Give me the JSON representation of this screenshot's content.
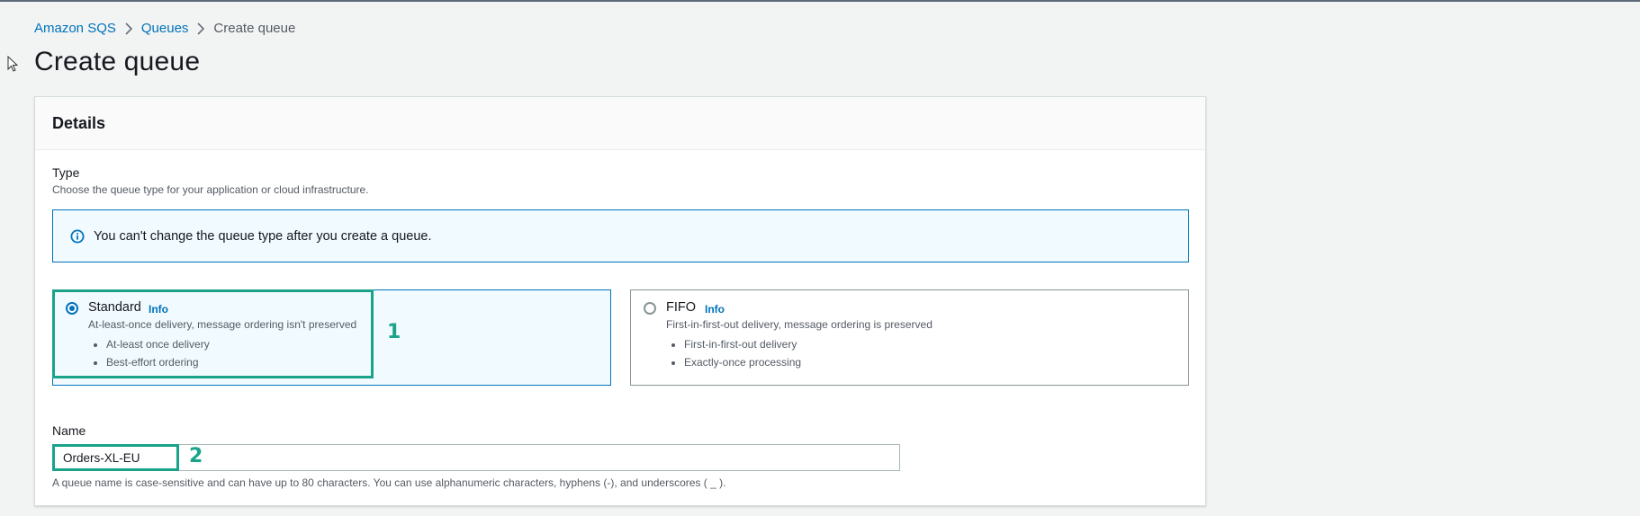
{
  "breadcrumb": {
    "items": [
      "Amazon SQS",
      "Queues"
    ],
    "current": "Create queue"
  },
  "page": {
    "title": "Create queue"
  },
  "details": {
    "header": "Details",
    "type": {
      "label": "Type",
      "description": "Choose the queue type for your application or cloud infrastructure.",
      "alert": "You can't change the queue type after you create a queue.",
      "options": [
        {
          "title": "Standard",
          "info": "Info",
          "description": "At-least-once delivery, message ordering isn't preserved",
          "bullets": [
            "At-least once delivery",
            "Best-effort ordering"
          ],
          "selected": true
        },
        {
          "title": "FIFO",
          "info": "Info",
          "description": "First-in-first-out delivery, message ordering is preserved",
          "bullets": [
            "First-in-first-out delivery",
            "Exactly-once processing"
          ],
          "selected": false
        }
      ]
    },
    "name": {
      "label": "Name",
      "value": "Orders-XL-EU",
      "hint": "A queue name is case-sensitive and can have up to 80 characters. You can use alphanumeric characters, hyphens (-), and underscores ( _ )."
    }
  },
  "annotations": [
    "1",
    "2"
  ],
  "colors": {
    "link": "#0073bb",
    "annotation": "#1aa389",
    "selected_background": "#f1faff"
  },
  "icons": [
    "mouse-cursor-icon",
    "chevron-right-icon",
    "info-circle-icon"
  ]
}
